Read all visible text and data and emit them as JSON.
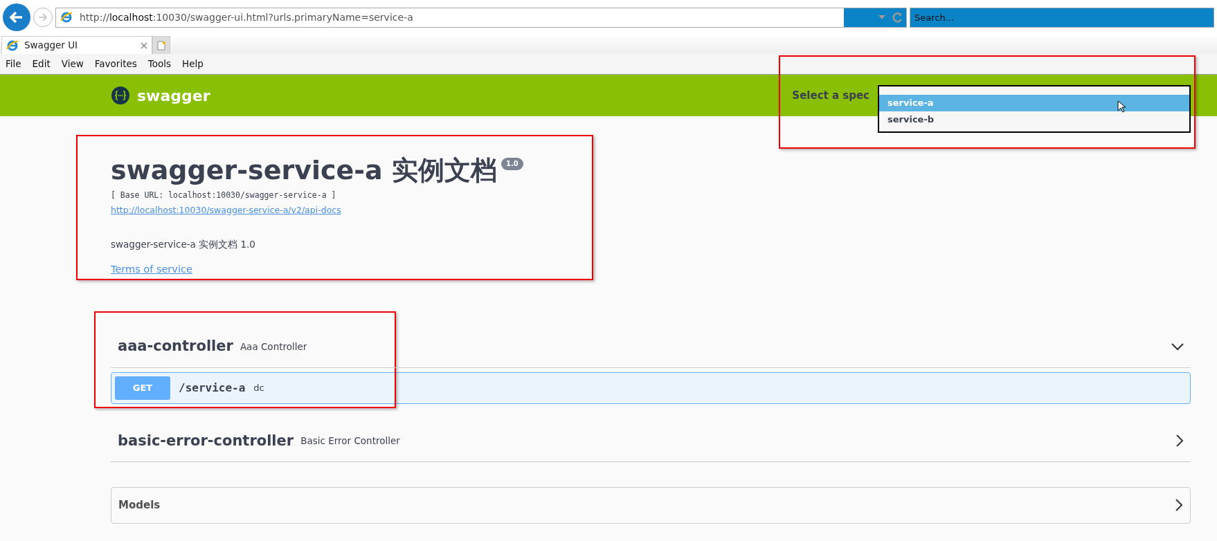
{
  "browser": {
    "address": {
      "scheme": "http://",
      "host": "localhost",
      "rest": ":10030/swagger-ui.html?urls.primaryName=service-a"
    },
    "search": {
      "placeholder": "Search..."
    },
    "tabs": [
      {
        "label": "Swagger UI",
        "selected": true
      }
    ],
    "menu": [
      "File",
      "Edit",
      "View",
      "Favorites",
      "Tools",
      "Help"
    ]
  },
  "header": {
    "logo_text": "swagger",
    "spec_label": "Select a spec",
    "spec_options": [
      {
        "label": "service-a",
        "selected": true
      },
      {
        "label": "service-b",
        "selected": false
      }
    ]
  },
  "info": {
    "title": "swagger-service-a 实例文档",
    "version": "1.0",
    "base_url": "[ Base URL: localhost:10030/swagger-service-a ]",
    "docs_link": "http://localhost:10030/swagger-service-a/v2/api-docs",
    "description": "swagger-service-a 实例文档 1.0",
    "terms": "Terms of service"
  },
  "tags": [
    {
      "name": "aaa-controller",
      "description": "Aaa Controller",
      "expanded": true,
      "operations": [
        {
          "method": "GET",
          "path": "/service-a",
          "summary": "dc"
        }
      ]
    },
    {
      "name": "basic-error-controller",
      "description": "Basic Error Controller",
      "expanded": false
    }
  ],
  "models": {
    "title": "Models",
    "expanded": false
  }
}
